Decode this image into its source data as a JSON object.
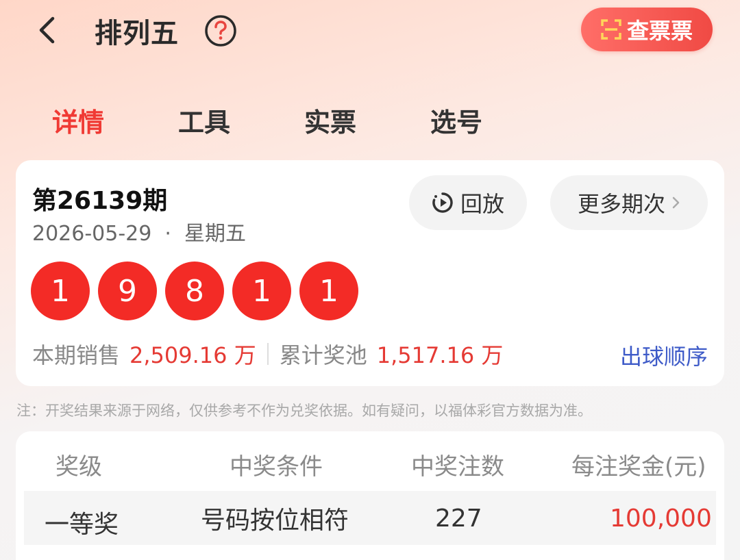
{
  "header": {
    "title": "排列五",
    "ticket_button": "查票票"
  },
  "tabs": [
    {
      "label": "详情",
      "active": true
    },
    {
      "label": "工具",
      "active": false
    },
    {
      "label": "实票",
      "active": false
    },
    {
      "label": "选号",
      "active": false
    }
  ],
  "draw": {
    "issue": "第26139期",
    "date_line": "2026-05-29  ·  星期五",
    "replay_label": "回放",
    "more_label": "更多期次",
    "numbers": [
      "1",
      "9",
      "8",
      "1",
      "1"
    ],
    "sales_label": "本期销售",
    "sales_value": "2,509.16 万",
    "pool_label": "累计奖池",
    "pool_value": "1,517.16 万",
    "order_link": "出球顺序"
  },
  "note": "注：开奖结果来源于网络，仅供参考不作为兑奖依据。如有疑问，以福体彩官方数据为准。",
  "prize_table": {
    "headers": [
      "奖级",
      "中奖条件",
      "中奖注数",
      "每注奖金(元)"
    ],
    "rows": [
      {
        "level": "一等奖",
        "condition": "号码按位相符",
        "count": "227",
        "amount": "100,000"
      }
    ]
  },
  "colors": {
    "accent_red": "#f03a34",
    "ball_red": "#f32b26",
    "link_blue": "#3e5bc8"
  }
}
